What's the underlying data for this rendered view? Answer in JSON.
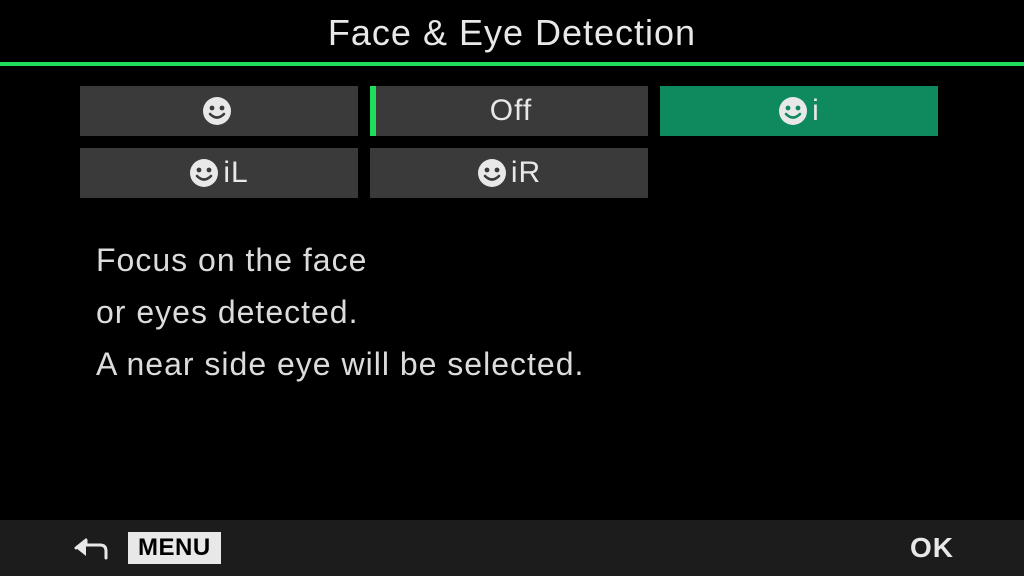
{
  "title": "Face & Eye Detection",
  "options": [
    {
      "icon": "face",
      "suffix": "",
      "current": false,
      "selected": false
    },
    {
      "icon": "",
      "suffix": "Off",
      "current": true,
      "selected": false
    },
    {
      "icon": "face",
      "suffix": "i",
      "current": false,
      "selected": true
    },
    {
      "icon": "face",
      "suffix": "iL",
      "current": false,
      "selected": false
    },
    {
      "icon": "face",
      "suffix": "iR",
      "current": false,
      "selected": false
    }
  ],
  "description": {
    "line1": "Focus on the face",
    "line2": "or eyes detected.",
    "line3": "A near side eye will be selected."
  },
  "footer": {
    "menu_label": "MENU",
    "ok_label": "OK"
  }
}
